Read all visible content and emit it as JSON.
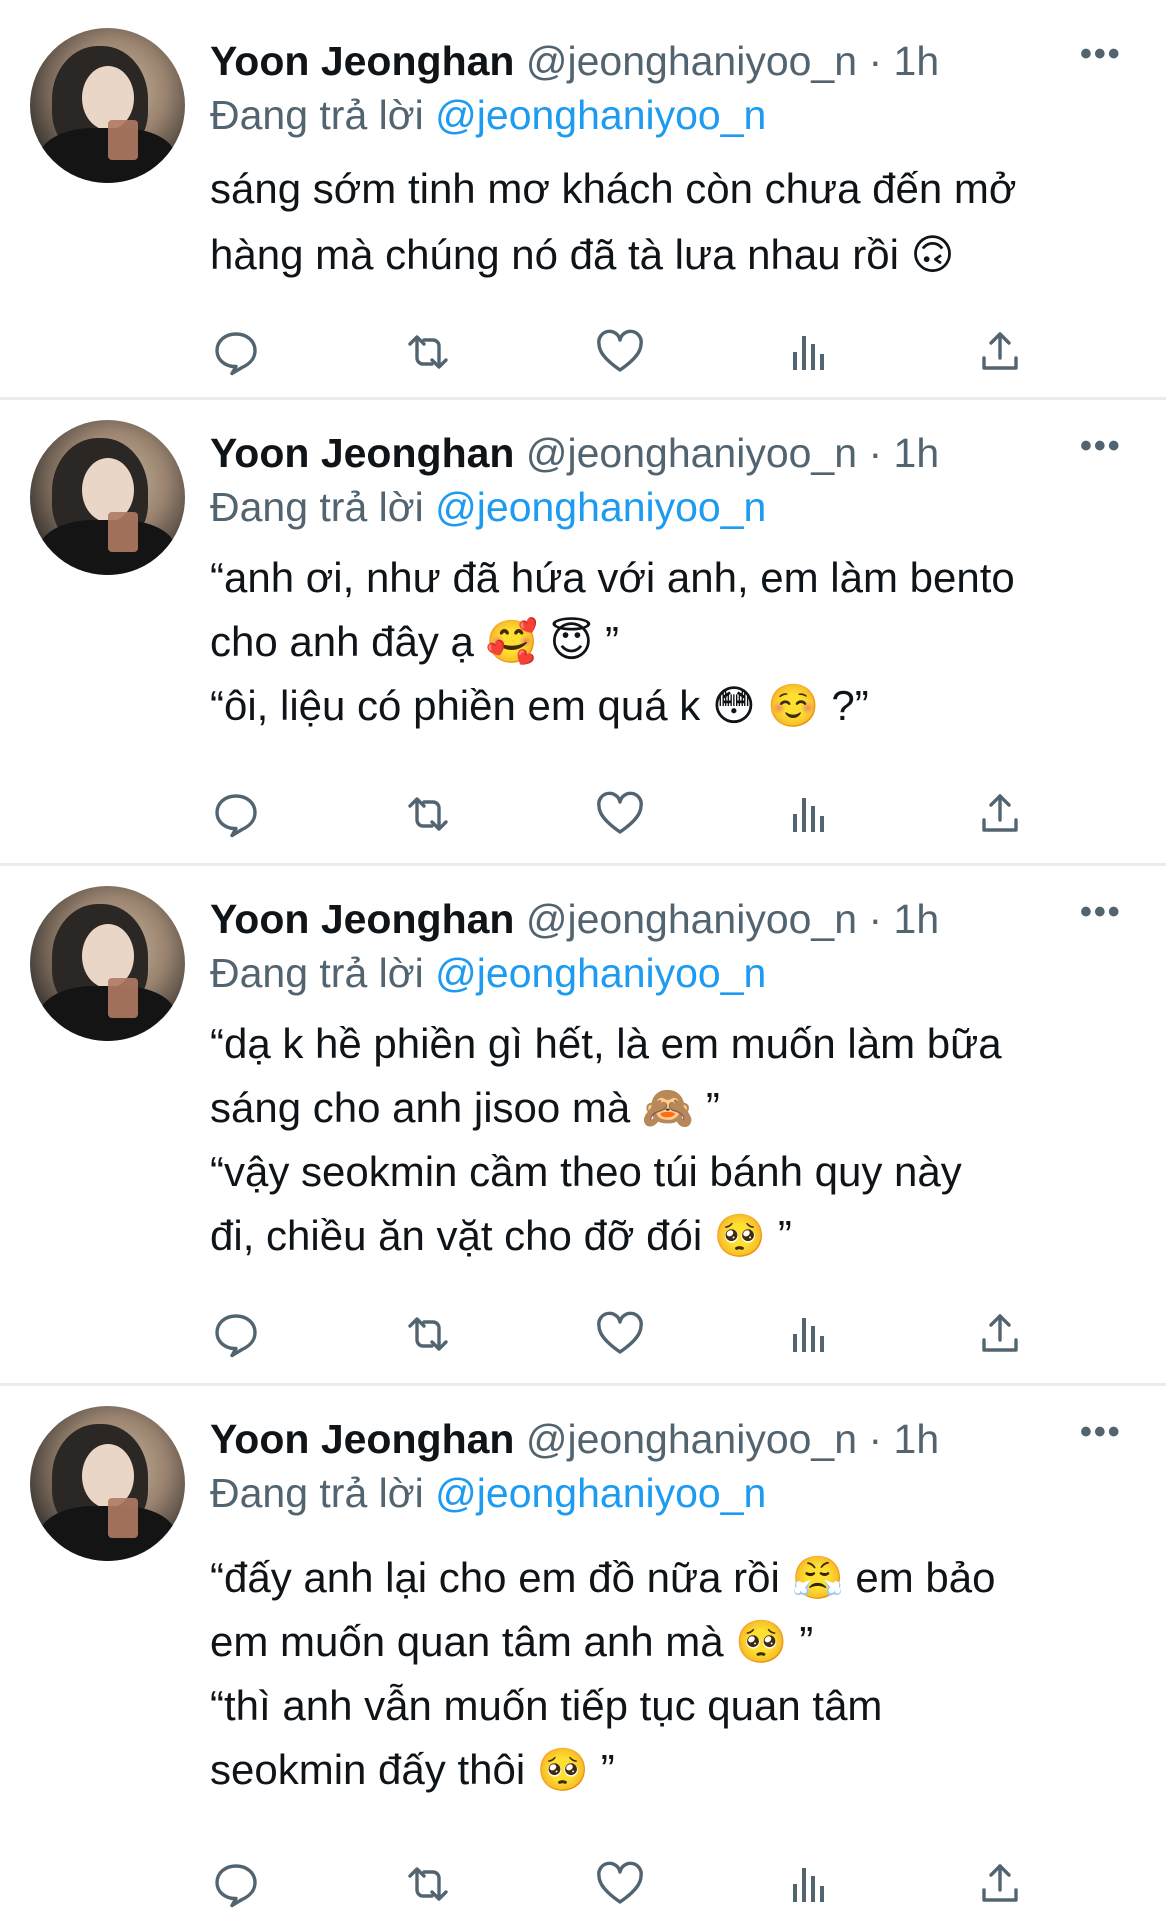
{
  "tweets": [
    {
      "author": "Yoon Jeonghan",
      "handle": "@jeonghaniyoo_n",
      "sep": "·",
      "time": "1h",
      "more": "•••",
      "reply_prefix": "Đang trả lời",
      "reply_to": "@jeonghaniyoo_n",
      "lines": [
        "sáng sớm tinh mơ khách còn chưa đến mở",
        "hàng mà chúng nó đã tà lưa nhau rồi 🙃"
      ]
    },
    {
      "author": "Yoon Jeonghan",
      "handle": "@jeonghaniyoo_n",
      "sep": "·",
      "time": "1h",
      "more": "•••",
      "reply_prefix": "Đang trả lời",
      "reply_to": "@jeonghaniyoo_n",
      "lines": [
        "“anh ơi, như đã hứa với anh, em làm bento",
        "cho anh đây ạ 🥰 😇 ”",
        "“ôi, liệu có phiền em quá k 😳 ☺️ ?”"
      ]
    },
    {
      "author": "Yoon Jeonghan",
      "handle": "@jeonghaniyoo_n",
      "sep": "·",
      "time": "1h",
      "more": "•••",
      "reply_prefix": "Đang trả lời",
      "reply_to": "@jeonghaniyoo_n",
      "lines": [
        "“dạ k hề phiền gì hết, là em muốn làm bữa",
        "sáng cho anh jisoo mà 🙈 ”",
        "“vậy seokmin cầm theo túi bánh quy này",
        "đi, chiều ăn vặt cho đỡ đói 🥺 ”"
      ]
    },
    {
      "author": "Yoon Jeonghan",
      "handle": "@jeonghaniyoo_n",
      "sep": "·",
      "time": "1h",
      "more": "•••",
      "reply_prefix": "Đang trả lời",
      "reply_to": "@jeonghaniyoo_n",
      "lines": [
        "“đấy anh lại cho em đồ nữa rồi 😤 em bảo",
        "em muốn quan tâm anh mà 🥺 ”",
        "“thì anh vẫn muốn tiếp tục quan tâm",
        "seokmin đấy thôi 🥺 ”"
      ]
    }
  ],
  "action_icons": [
    "reply-icon",
    "retweet-icon",
    "like-icon",
    "views-icon",
    "share-icon"
  ],
  "colors": {
    "text": "#0f1419",
    "secondary": "#536471",
    "link": "#1d9bf0",
    "divider": "#e9ecee"
  }
}
